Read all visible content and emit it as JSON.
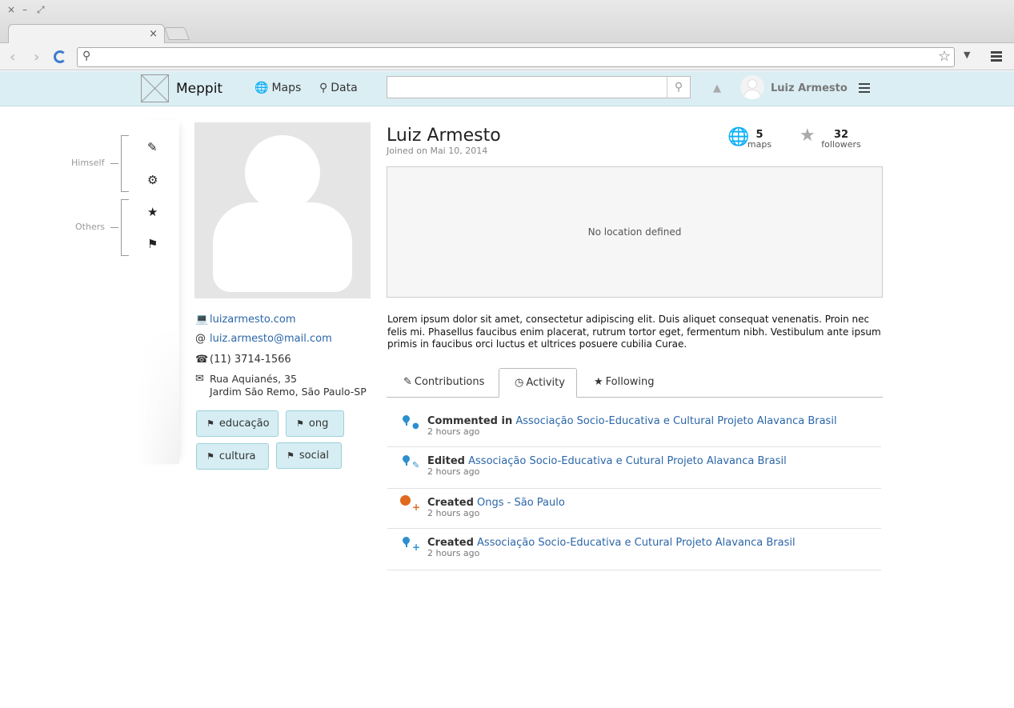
{
  "browser": {
    "tab_close": "×",
    "back": "‹",
    "forward": "›",
    "url": "",
    "window_close": "×",
    "window_min": "–",
    "window_max": "⤢"
  },
  "header": {
    "app_name": "Meppit",
    "nav": [
      {
        "label": "Maps",
        "icon": "globe-icon"
      },
      {
        "label": "Data",
        "icon": "map-marker-icon"
      }
    ],
    "search_placeholder": "",
    "user_name": "Luiz Armesto"
  },
  "sidebar": {
    "groups": [
      {
        "label": "Himself",
        "items": [
          {
            "icon": "pencil-icon"
          },
          {
            "icon": "gear-icon"
          }
        ]
      },
      {
        "label": "Others",
        "items": [
          {
            "icon": "star-icon"
          },
          {
            "icon": "flag-icon"
          }
        ]
      }
    ]
  },
  "profile": {
    "name": "Luiz Armesto",
    "joined": "Joined on Mai 10, 2014",
    "website": "luizarmesto.com",
    "email": "luiz.armesto@mail.com",
    "phone": "(11) 3714-1566",
    "address_line1": "Rua Aquianés, 35",
    "address_line2": "Jardim São Remo, São Paulo-SP",
    "tags": [
      "educação",
      "ong",
      "cultura",
      "social"
    ],
    "stats": {
      "maps_count": "5",
      "maps_label": "maps",
      "followers_count": "32",
      "followers_label": "followers"
    },
    "location_text": "No location defined",
    "bio": "Lorem ipsum dolor sit amet, consectetur adipiscing elit. Duis aliquet consequat venenatis. Proin nec felis mi. Phasellus faucibus enim placerat, rutrum tortor eget, fermentum nibh. Vestibulum ante ipsum primis in faucibus orci luctus et ultrices posuere cubilia Curae."
  },
  "tabs": [
    {
      "label": "Contributions",
      "icon": "edit-icon",
      "active": false
    },
    {
      "label": "Activity",
      "icon": "clock-icon",
      "active": true
    },
    {
      "label": "Following",
      "icon": "star-icon",
      "active": false
    }
  ],
  "activity": [
    {
      "action": "Commented in",
      "target": "Associação Socio-Educativa e Cultural Projeto Alavanca Brasil",
      "time": "2 hours ago",
      "icon": "marker-comment-icon"
    },
    {
      "action": "Edited",
      "target": "Associação Socio-Educativa e Cutural Projeto Alavanca Brasil",
      "time": "2 hours ago",
      "icon": "marker-edit-icon"
    },
    {
      "action": "Created",
      "target": "Ongs - São Paulo",
      "time": "2 hours ago",
      "icon": "map-add-icon"
    },
    {
      "action": "Created",
      "target": "Associação Socio-Educativa e Cutural Projeto Alavanca Brasil",
      "time": "2 hours ago",
      "icon": "marker-add-icon"
    }
  ],
  "colors": {
    "header_bg": "#dbeef4",
    "link": "#2b66a8",
    "marker": "#2c8fd0",
    "map_orange": "#e06a1d",
    "tag_bg": "#d6eef3"
  }
}
